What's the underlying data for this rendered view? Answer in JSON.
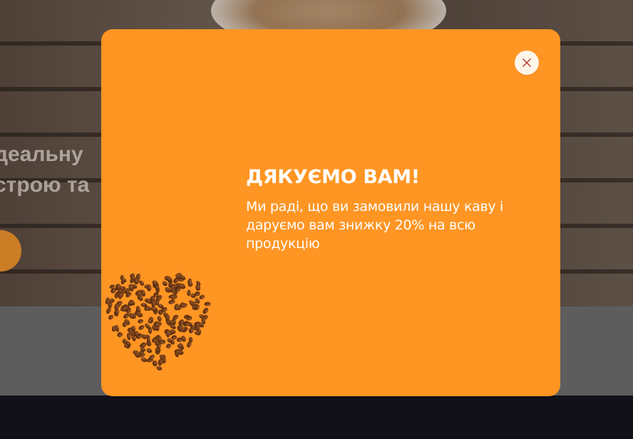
{
  "background": {
    "hero_line1": "деальну",
    "hero_line2": "строю та"
  },
  "modal": {
    "title": "ДЯКУЄМО ВАМ!",
    "message": "Ми раді, що ви замовили нашу каву і даруємо вам знижку 20% на всю продукцію",
    "close_icon": "close-icon",
    "illustration_icon": "coffee-bean-heart",
    "colors": {
      "modal_bg": "#ff9523",
      "close_bg": "#fff6ea",
      "close_x": "#c0392b",
      "text": "#ffffff"
    }
  }
}
